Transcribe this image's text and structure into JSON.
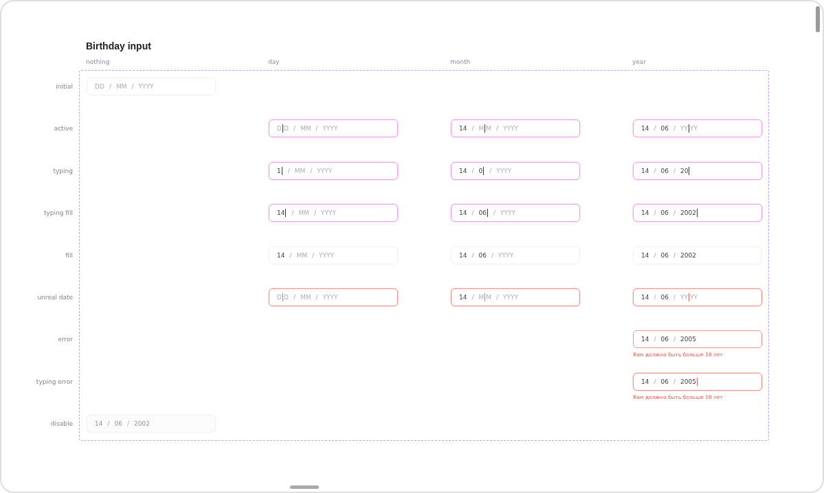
{
  "title": "Birthday input",
  "columns": [
    "nothing",
    "day",
    "month",
    "year"
  ],
  "rows": [
    {
      "label": "initial",
      "cells": [
        {
          "focused": false,
          "invalid": false,
          "disabled": false,
          "separators": [
            "/",
            "/"
          ],
          "segments": [
            {
              "text": "DD",
              "filled": false,
              "caret": false
            },
            {
              "text": "MM",
              "filled": false,
              "caret": false
            },
            {
              "text": "YYYY",
              "filled": false,
              "caret": false
            }
          ]
        },
        null,
        null,
        null
      ]
    },
    {
      "label": "active",
      "cells": [
        null,
        {
          "focused": true,
          "invalid": false,
          "disabled": false,
          "separators": [
            "/",
            "/"
          ],
          "segments": [
            {
              "text": "D",
              "text_after_caret": "D",
              "filled": false,
              "caret": true
            },
            {
              "text": "MM",
              "filled": false,
              "caret": false
            },
            {
              "text": "YYYY",
              "filled": false,
              "caret": false
            }
          ]
        },
        {
          "focused": true,
          "invalid": false,
          "disabled": false,
          "separators": [
            "/",
            "/"
          ],
          "segments": [
            {
              "text": "14",
              "filled": true,
              "caret": false
            },
            {
              "text": "M",
              "text_after_caret": "M",
              "filled": false,
              "caret": true
            },
            {
              "text": "YYYY",
              "filled": false,
              "caret": false
            }
          ]
        },
        {
          "focused": true,
          "invalid": false,
          "disabled": false,
          "separators": [
            "/",
            "/"
          ],
          "segments": [
            {
              "text": "14",
              "filled": true,
              "caret": false
            },
            {
              "text": "06",
              "filled": true,
              "caret": false
            },
            {
              "text": "YY",
              "text_after_caret": "YY",
              "filled": false,
              "caret": true
            }
          ]
        }
      ]
    },
    {
      "label": "typing",
      "cells": [
        null,
        {
          "focused": true,
          "invalid": false,
          "disabled": false,
          "separators": [
            "/",
            "/"
          ],
          "segments": [
            {
              "text": "1",
              "filled": true,
              "caret": true
            },
            {
              "text": "MM",
              "filled": false,
              "caret": false
            },
            {
              "text": "YYYY",
              "filled": false,
              "caret": false
            }
          ]
        },
        {
          "focused": true,
          "invalid": false,
          "disabled": false,
          "separators": [
            "/",
            "/"
          ],
          "segments": [
            {
              "text": "14",
              "filled": true,
              "caret": false
            },
            {
              "text": "0",
              "filled": true,
              "caret": true
            },
            {
              "text": "YYYY",
              "filled": false,
              "caret": false
            }
          ]
        },
        {
          "focused": true,
          "invalid": false,
          "disabled": false,
          "separators": [
            "/",
            "/"
          ],
          "segments": [
            {
              "text": "14",
              "filled": true,
              "caret": false
            },
            {
              "text": "06",
              "filled": true,
              "caret": false
            },
            {
              "text": "20",
              "filled": true,
              "caret": true
            }
          ]
        }
      ]
    },
    {
      "label": "typing fill",
      "cells": [
        null,
        {
          "focused": true,
          "invalid": false,
          "disabled": false,
          "separators": [
            "/",
            "/"
          ],
          "segments": [
            {
              "text": "14",
              "filled": true,
              "caret": true
            },
            {
              "text": "MM",
              "filled": false,
              "caret": false
            },
            {
              "text": "YYYY",
              "filled": false,
              "caret": false
            }
          ]
        },
        {
          "focused": true,
          "invalid": false,
          "disabled": false,
          "separators": [
            "/",
            "/"
          ],
          "segments": [
            {
              "text": "14",
              "filled": true,
              "caret": false
            },
            {
              "text": "06",
              "filled": true,
              "caret": true
            },
            {
              "text": "YYYY",
              "filled": false,
              "caret": false
            }
          ]
        },
        {
          "focused": true,
          "invalid": false,
          "disabled": false,
          "separators": [
            "/",
            "/"
          ],
          "segments": [
            {
              "text": "14",
              "filled": true,
              "caret": false
            },
            {
              "text": "06",
              "filled": true,
              "caret": false
            },
            {
              "text": "2002",
              "filled": true,
              "caret": true
            }
          ]
        }
      ]
    },
    {
      "label": "fill",
      "cells": [
        null,
        {
          "focused": false,
          "invalid": false,
          "disabled": false,
          "separators": [
            "/",
            "/"
          ],
          "segments": [
            {
              "text": "14",
              "filled": true,
              "caret": false
            },
            {
              "text": "MM",
              "filled": false,
              "caret": false
            },
            {
              "text": "YYYY",
              "filled": false,
              "caret": false
            }
          ]
        },
        {
          "focused": false,
          "invalid": false,
          "disabled": false,
          "separators": [
            "/",
            "/"
          ],
          "segments": [
            {
              "text": "14",
              "filled": true,
              "caret": false
            },
            {
              "text": "06",
              "filled": true,
              "caret": false
            },
            {
              "text": "YYYY",
              "filled": false,
              "caret": false
            }
          ]
        },
        {
          "focused": false,
          "invalid": false,
          "disabled": false,
          "separators": [
            "/",
            "/"
          ],
          "segments": [
            {
              "text": "14",
              "filled": true,
              "caret": false
            },
            {
              "text": "06",
              "filled": true,
              "caret": false
            },
            {
              "text": "2002",
              "filled": true,
              "caret": false
            }
          ]
        }
      ]
    },
    {
      "label": "unreal date",
      "cells": [
        null,
        {
          "focused": true,
          "invalid": true,
          "disabled": false,
          "separators": [
            "/",
            "/"
          ],
          "segments": [
            {
              "text": "D",
              "text_after_caret": "D",
              "filled": false,
              "caret": true
            },
            {
              "text": "MM",
              "filled": false,
              "caret": false
            },
            {
              "text": "YYYY",
              "filled": false,
              "caret": false
            }
          ]
        },
        {
          "focused": true,
          "invalid": true,
          "disabled": false,
          "separators": [
            "/",
            "/"
          ],
          "segments": [
            {
              "text": "14",
              "filled": true,
              "caret": false
            },
            {
              "text": "M",
              "text_after_caret": "M",
              "filled": false,
              "caret": true
            },
            {
              "text": "YYYY",
              "filled": false,
              "caret": false
            }
          ]
        },
        {
          "focused": true,
          "invalid": true,
          "disabled": false,
          "separators": [
            "/",
            "/"
          ],
          "segments": [
            {
              "text": "14",
              "filled": true,
              "caret": false
            },
            {
              "text": "06",
              "filled": true,
              "caret": false
            },
            {
              "text": "YY",
              "text_after_caret": "YY",
              "filled": false,
              "caret": true
            }
          ]
        }
      ]
    },
    {
      "label": "error",
      "cells": [
        null,
        null,
        null,
        {
          "focused": false,
          "invalid": true,
          "disabled": false,
          "separators": [
            "/",
            "/"
          ],
          "segments": [
            {
              "text": "14",
              "filled": true,
              "caret": false
            },
            {
              "text": "06",
              "filled": true,
              "caret": false
            },
            {
              "text": "2005",
              "filled": true,
              "caret": false
            }
          ],
          "message": "Вам должно быть больше 18 лет"
        }
      ]
    },
    {
      "label": "typing error",
      "cells": [
        null,
        null,
        null,
        {
          "focused": true,
          "invalid": true,
          "disabled": false,
          "separators": [
            "/",
            "/"
          ],
          "segments": [
            {
              "text": "14",
              "filled": true,
              "caret": false
            },
            {
              "text": "06",
              "filled": true,
              "caret": false
            },
            {
              "text": "2005",
              "filled": true,
              "caret": true
            }
          ],
          "message": "Вам должно быть больше 18 лет"
        }
      ]
    },
    {
      "label": "disable",
      "cells": [
        {
          "focused": false,
          "invalid": false,
          "disabled": true,
          "separators": [
            "/",
            "/"
          ],
          "segments": [
            {
              "text": "14",
              "filled": true,
              "caret": false
            },
            {
              "text": "06",
              "filled": true,
              "caret": false
            },
            {
              "text": "2002",
              "filled": true,
              "caret": false
            }
          ]
        },
        null,
        null,
        null
      ]
    }
  ]
}
